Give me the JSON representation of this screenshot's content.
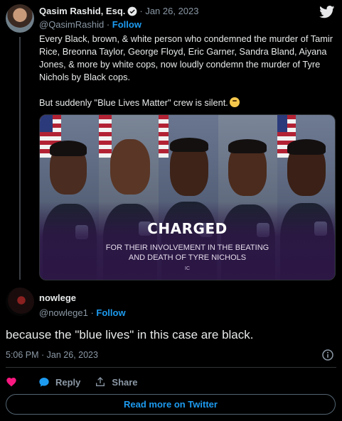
{
  "quoted_tweet": {
    "author_name": "Qasim Rashid, Esq.",
    "date": "· Jan 26, 2023",
    "handle": "@QasimRashid",
    "separator": " · ",
    "follow_label": "Follow",
    "paragraph1": "Every Black, brown, & white person who condemned the murder of Tamir Rice, Breonna Taylor, George Floyd, Eric Garner, Sandra Bland, Aiyana Jones, & more by white cops, now loudly condemn the murder of Tyre Nichols by Black cops.",
    "paragraph2": "But suddenly \"Blue Lives Matter\" crew is silent.",
    "emoji": "thinking-face-emoji",
    "media": {
      "headline": "CHARGED",
      "subline1": "FOR THEIR INVOLVEMENT IN THE BEATING",
      "subline2": "AND DEATH OF TYRE NICHOLS",
      "watermark": "IC"
    }
  },
  "reply": {
    "author_name": "nowlege",
    "handle": "@nowlege1",
    "separator": " · ",
    "follow_label": "Follow",
    "text": "because the \"blue lives\" in this case are black.",
    "timestamp": "5:06 PM · Jan 26, 2023"
  },
  "actions": {
    "reply_label": "Reply",
    "share_label": "Share"
  },
  "read_more_label": "Read more on Twitter",
  "colors": {
    "background": "#000000",
    "text": "#e7e9ea",
    "muted": "#8b98a5",
    "accent": "#1d9bf0",
    "like": "#f91880"
  },
  "icons": [
    "verified-badge-icon",
    "twitter-bird-icon",
    "info-icon",
    "heart-icon",
    "reply-bubble-icon",
    "share-icon"
  ]
}
